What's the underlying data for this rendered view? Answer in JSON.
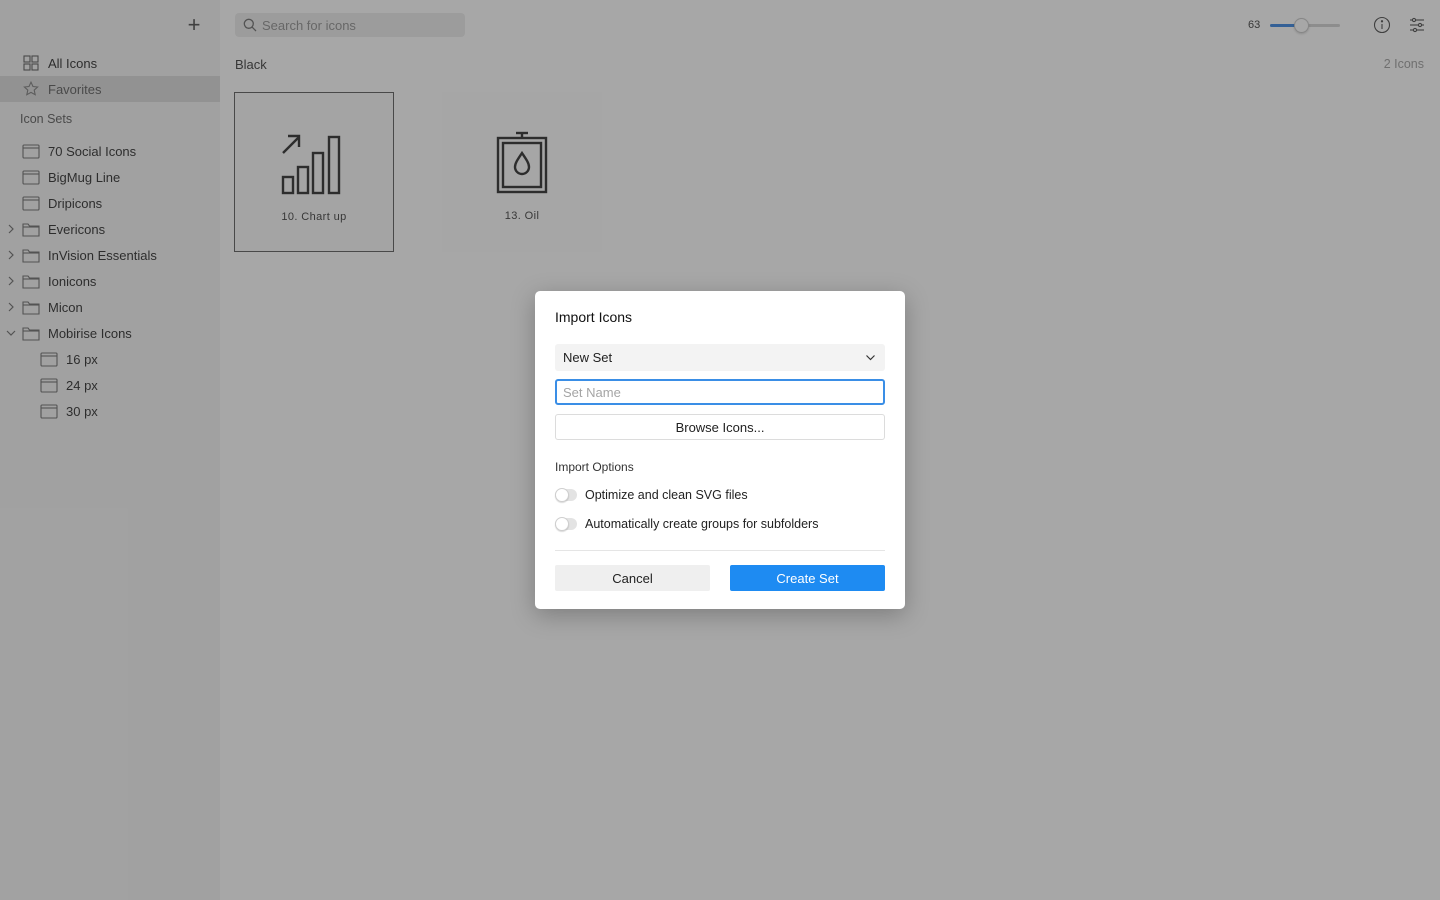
{
  "sidebar": {
    "add_label": "+",
    "nav": [
      {
        "label": "All Icons",
        "icon": "grid-icon"
      },
      {
        "label": "Favorites",
        "icon": "star-icon",
        "selected": true
      }
    ],
    "section_title": "Icon Sets",
    "sets": [
      {
        "label": "70 Social Icons",
        "icon": "box-icon"
      },
      {
        "label": "BigMug Line",
        "icon": "box-icon"
      },
      {
        "label": "Dripicons",
        "icon": "box-icon"
      },
      {
        "label": "Evericons",
        "icon": "folder-icon",
        "expandable": true
      },
      {
        "label": "InVision Essentials",
        "icon": "folder-icon",
        "expandable": true
      },
      {
        "label": "Ionicons",
        "icon": "folder-icon",
        "expandable": true
      },
      {
        "label": "Micon",
        "icon": "folder-icon",
        "expandable": true
      },
      {
        "label": "Mobirise Icons",
        "icon": "folder-icon",
        "expandable": true,
        "expanded": true
      },
      {
        "label": "16 px",
        "icon": "box-icon",
        "child": true
      },
      {
        "label": "24 px",
        "icon": "box-icon",
        "child": true
      },
      {
        "label": "30 px",
        "icon": "box-icon",
        "child": true
      }
    ]
  },
  "toolbar": {
    "search_placeholder": "Search for icons",
    "zoom_value": "63",
    "zoom_fraction": 0.45
  },
  "main": {
    "group_title": "Black",
    "icon_count": "2 Icons",
    "icons": [
      {
        "label": "10. Chart up",
        "icon": "chart-up-icon",
        "selected": true
      },
      {
        "label": "13. Oil",
        "icon": "oil-barrel-icon"
      }
    ]
  },
  "dialog": {
    "title": "Import Icons",
    "select_value": "New Set",
    "name_placeholder": "Set Name",
    "browse_label": "Browse Icons...",
    "options_title": "Import Options",
    "options": [
      {
        "label": "Optimize and clean SVG files",
        "enabled": false
      },
      {
        "label": "Automatically create groups for subfolders",
        "enabled": false
      }
    ],
    "cancel_label": "Cancel",
    "create_label": "Create Set"
  },
  "colors": {
    "accent": "#1e8bf2",
    "focus": "#3a8ee6"
  }
}
